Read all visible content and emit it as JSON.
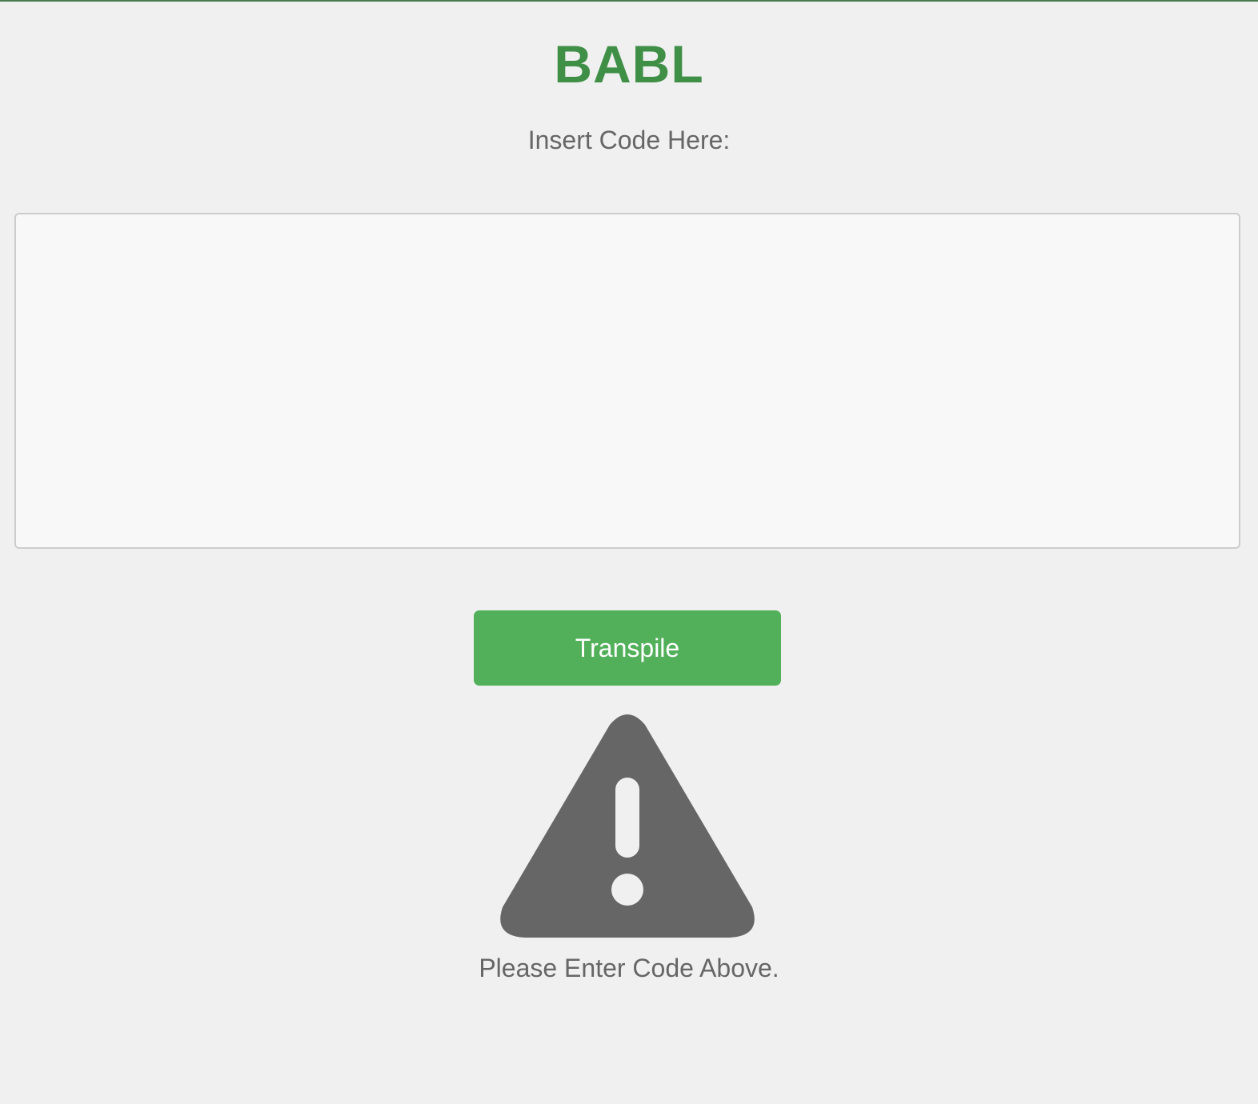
{
  "app": {
    "title": "BABL",
    "input_label": "Insert Code Here:",
    "code_value": "",
    "transpile_label": "Transpile",
    "status_icon": "warning-triangle-icon",
    "status_message": "Please Enter Code Above."
  },
  "colors": {
    "brand": "#3f8f47",
    "button": "#52b05a",
    "text_muted": "#666666",
    "background": "#f0f0f0"
  }
}
